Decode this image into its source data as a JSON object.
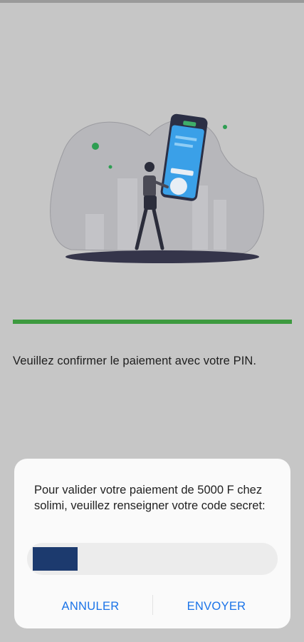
{
  "payment": {
    "instruction": "Veuillez confirmer le paiement avec votre PIN.",
    "progress_percent": 100,
    "progress_color": "#3d9a3f"
  },
  "dialog": {
    "message": "Pour valider votre paiement de 5000 F chez solimi, veuillez renseigner votre code secret:",
    "pin_value": "",
    "cancel_label": "ANNULER",
    "submit_label": "ENVOYER",
    "accent_color": "#1a73e8"
  },
  "illustration": {
    "icon": "person-holding-phone-illustration"
  }
}
